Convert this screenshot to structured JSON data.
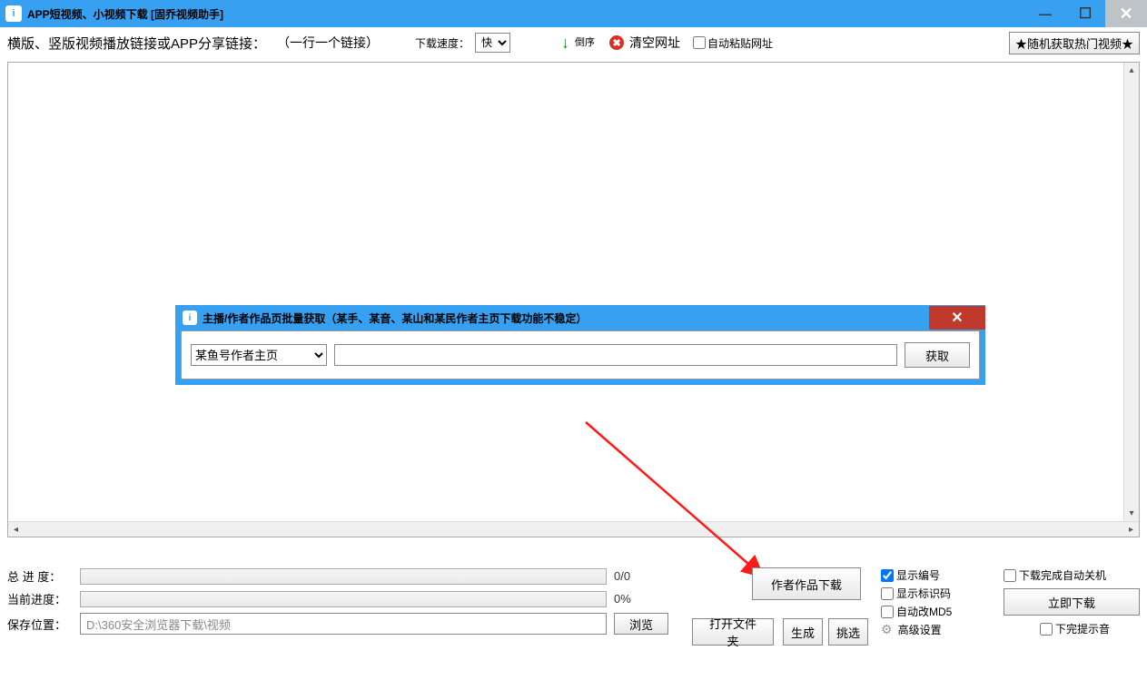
{
  "titlebar": {
    "title": "APP短视频、小视频下载 [固乔视频助手]"
  },
  "toolbar": {
    "link_label": "横版、竖版视频播放链接或APP分享链接：",
    "link_hint": "（一行一个链接）",
    "speed_label": "下载速度：",
    "speed_value": "快",
    "daoxu": "倒序",
    "clear_url": "清空网址",
    "auto_paste": "自动粘贴网址",
    "random_hot": "★随机获取热门视频★"
  },
  "dialog": {
    "title": "主播/作者作品页批量获取（某手、某音、某山和某民作者主页下载功能不稳定）",
    "source_value": "某鱼号作者主页",
    "input_value": "",
    "fetch_btn": "获取"
  },
  "bottom": {
    "total_progress_label": "总 进 度：",
    "current_progress_label": "当前进度：",
    "total_text": "0/0",
    "current_text": "0%",
    "author_download": "作者作品下载",
    "show_index": "显示编号",
    "show_id": "显示标识码",
    "auto_md5": "自动改MD5",
    "adv_settings": "高级设置",
    "save_path_label": "保存位置：",
    "save_path": "D:\\360安全浏览器下载\\视频",
    "browse": "浏览",
    "open_folder": "打开文件夹",
    "gen": "生成",
    "pick": "挑选",
    "download_now": "立即下载",
    "auto_shutdown": "下载完成自动关机",
    "finish_sound": "下完提示音"
  }
}
